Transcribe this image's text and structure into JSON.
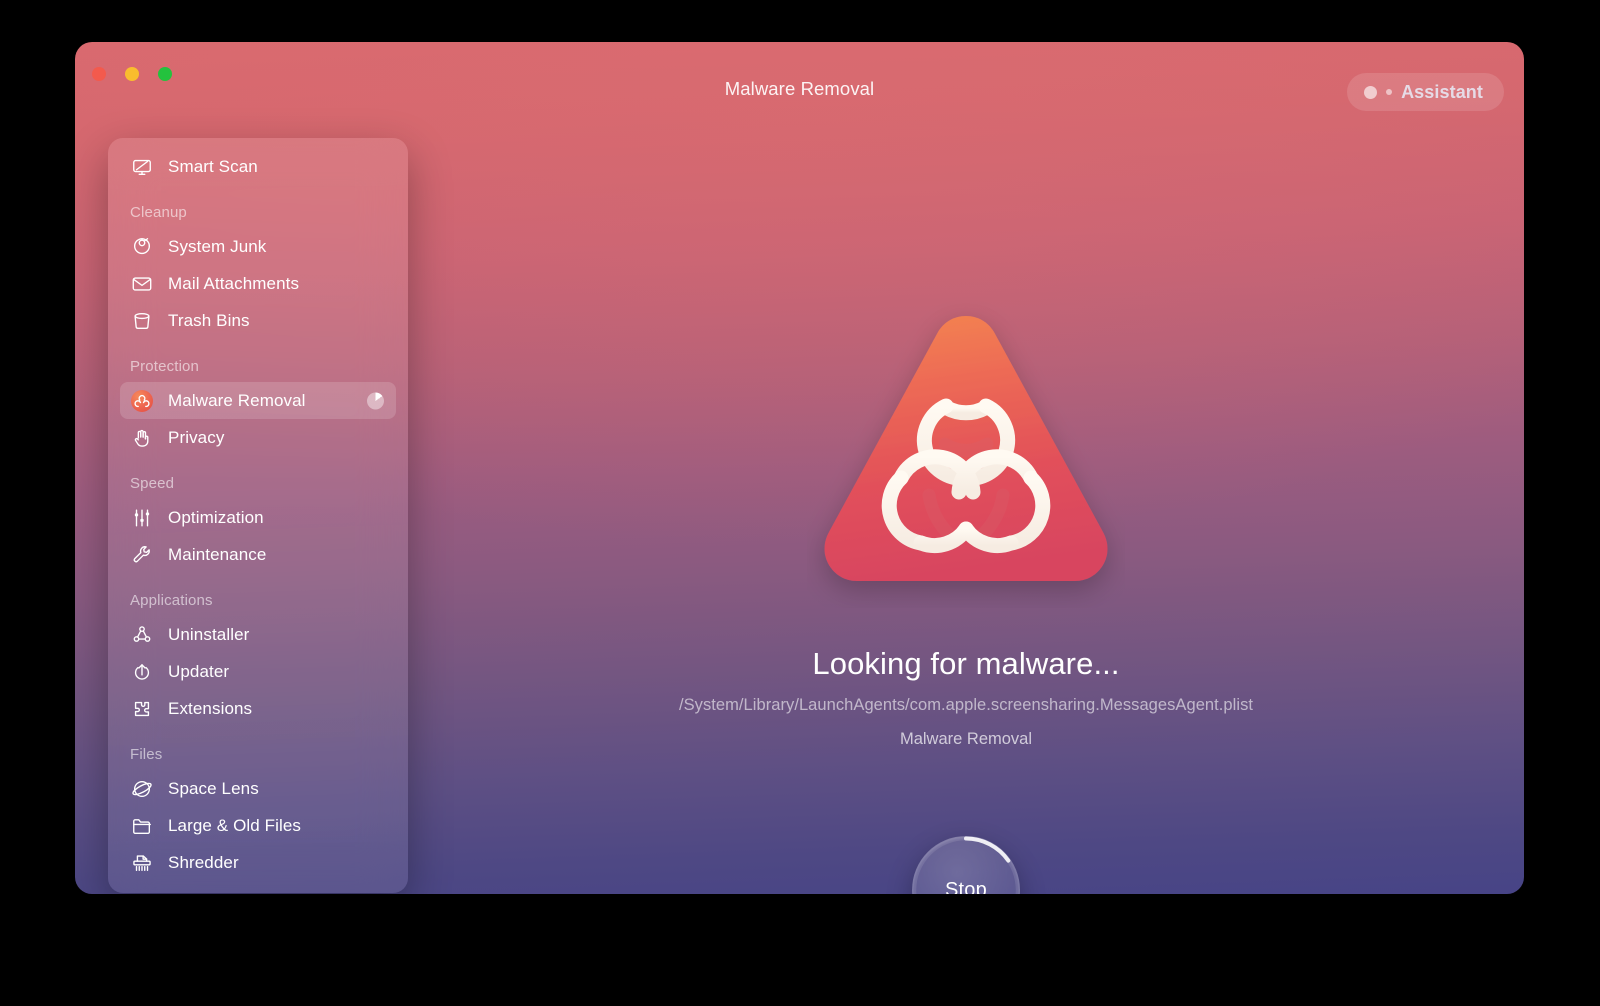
{
  "window": {
    "title": "Malware Removal",
    "traffic_lights": [
      "close",
      "minimize",
      "maximize"
    ],
    "gradient_top": "#d9696f",
    "gradient_mid": "#8a5a80",
    "gradient_bottom": "#474486"
  },
  "assistant": {
    "label": "Assistant"
  },
  "sidebar": {
    "items": [
      {
        "label": "Smart Scan",
        "icon": "monitor-icon",
        "type": "item",
        "selected": false
      },
      {
        "label": "Cleanup",
        "type": "group"
      },
      {
        "label": "System Junk",
        "icon": "broom-icon",
        "type": "item",
        "selected": false
      },
      {
        "label": "Mail Attachments",
        "icon": "envelope-icon",
        "type": "item",
        "selected": false
      },
      {
        "label": "Trash Bins",
        "icon": "trash-bin-icon",
        "type": "item",
        "selected": false
      },
      {
        "label": "Protection",
        "type": "group"
      },
      {
        "label": "Malware Removal",
        "icon": "biohazard-icon",
        "type": "item",
        "selected": true,
        "progress": 15
      },
      {
        "label": "Privacy",
        "icon": "hand-icon",
        "type": "item",
        "selected": false
      },
      {
        "label": "Speed",
        "type": "group"
      },
      {
        "label": "Optimization",
        "icon": "sliders-icon",
        "type": "item",
        "selected": false
      },
      {
        "label": "Maintenance",
        "icon": "wrench-icon",
        "type": "item",
        "selected": false
      },
      {
        "label": "Applications",
        "type": "group"
      },
      {
        "label": "Uninstaller",
        "icon": "uninstall-icon",
        "type": "item",
        "selected": false
      },
      {
        "label": "Updater",
        "icon": "update-arrow-icon",
        "type": "item",
        "selected": false
      },
      {
        "label": "Extensions",
        "icon": "puzzle-piece-icon",
        "type": "item",
        "selected": false
      },
      {
        "label": "Files",
        "type": "group"
      },
      {
        "label": "Space Lens",
        "icon": "space-lens-icon",
        "type": "item",
        "selected": false
      },
      {
        "label": "Large & Old Files",
        "icon": "folder-icon",
        "type": "item",
        "selected": false
      },
      {
        "label": "Shredder",
        "icon": "shredder-icon",
        "type": "item",
        "selected": false
      }
    ]
  },
  "main": {
    "hero_icon": "biohazard-triangle-icon",
    "status_title": "Looking for malware...",
    "status_path": "/System/Library/LaunchAgents/com.apple.screensharing.MessagesAgent.plist",
    "status_module": "Malware Removal",
    "stop_button": {
      "label": "Stop",
      "progress": 15
    }
  }
}
